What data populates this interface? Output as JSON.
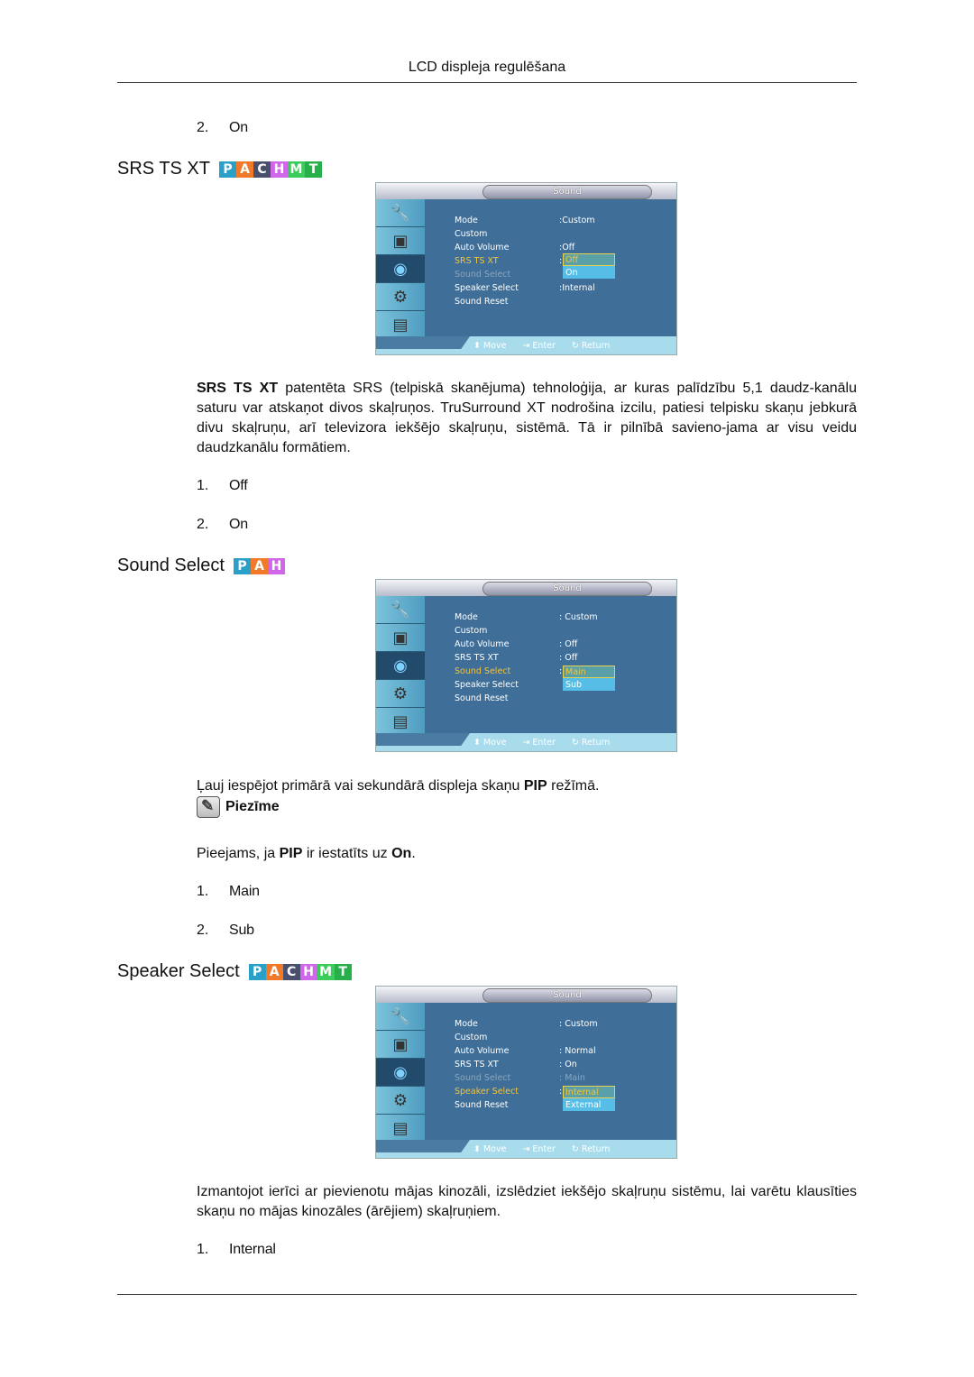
{
  "header": {
    "title": "LCD displeja regulēšana"
  },
  "top_list": [
    {
      "num": "2.",
      "label": "On"
    }
  ],
  "badge_colors": {
    "P": "#2aa0c8",
    "A": "#f07a2a",
    "C": "#4a4f6e",
    "H": "#d066e8",
    "M": "#3ccc5c",
    "T": "#27b04a"
  },
  "sections": [
    {
      "heading": "SRS TS XT",
      "badges": [
        "P",
        "A",
        "C",
        "H",
        "M",
        "T"
      ],
      "osd": {
        "title": "Sound",
        "rows": [
          {
            "label": "Mode",
            "value": ":Custom",
            "state": "normal"
          },
          {
            "label": "Custom",
            "value": "",
            "state": "normal"
          },
          {
            "label": "Auto Volume",
            "value": ":Off",
            "state": "normal"
          },
          {
            "label": "SRS TS XT",
            "value": ":",
            "state": "selected"
          },
          {
            "label": "Sound Select",
            "value": "",
            "state": "dim"
          },
          {
            "label": "Speaker Select",
            "value": ":Internal",
            "state": "normal"
          },
          {
            "label": "Sound Reset",
            "value": "",
            "state": "normal"
          }
        ],
        "dropdown": {
          "options": [
            "Off",
            "On"
          ],
          "highlighted": "Off"
        },
        "footer": {
          "move": "Move",
          "enter": "Enter",
          "return": "Return"
        }
      },
      "paragraph_bold": "SRS TS XT",
      "paragraph": " patentēta SRS (telpiskā skanējuma) tehnoloģija, ar kuras palīdzību 5,1 daudz-kanālu saturu var atskaņot divos skaļruņos. TruSurround XT nodrošina izcilu, patiesi telpisku skaņu jebkurā divu skaļruņu, arī televizora iekšējo skaļruņu, sistēmā. Tā ir pilnībā savieno-jama ar visu veidu daudzkanālu formātiem.",
      "list": [
        {
          "num": "1.",
          "label": "Off"
        },
        {
          "num": "2.",
          "label": "On"
        }
      ]
    },
    {
      "heading": "Sound Select",
      "badges": [
        "P",
        "A",
        "H"
      ],
      "osd": {
        "title": "Sound",
        "rows": [
          {
            "label": "Mode",
            "value": ": Custom",
            "state": "normal"
          },
          {
            "label": "Custom",
            "value": "",
            "state": "normal"
          },
          {
            "label": "Auto Volume",
            "value": ": Off",
            "state": "normal"
          },
          {
            "label": "SRS TS XT",
            "value": ": Off",
            "state": "normal"
          },
          {
            "label": "Sound Select",
            "value": ":",
            "state": "selected"
          },
          {
            "label": "Speaker Select",
            "value": "",
            "state": "normal"
          },
          {
            "label": "Sound Reset",
            "value": "",
            "state": "normal"
          }
        ],
        "dropdown": {
          "options": [
            "Main",
            "Sub"
          ],
          "highlighted": "Main"
        },
        "footer": {
          "move": "Move",
          "enter": "Enter",
          "return": "Return"
        }
      },
      "paragraph_pre": "Ļauj iespējot primārā vai sekundārā displeja skaņu ",
      "paragraph_bold": "PIP",
      "paragraph_post": " režīmā.",
      "note_label": "Piezīme",
      "note_pre": "Pieejams, ja ",
      "note_bold1": "PIP",
      "note_mid": " ir iestatīts uz ",
      "note_bold2": "On",
      "note_post": ".",
      "list": [
        {
          "num": "1.",
          "label": "Main"
        },
        {
          "num": "2.",
          "label": "Sub"
        }
      ]
    },
    {
      "heading": "Speaker Select",
      "badges": [
        "P",
        "A",
        "C",
        "H",
        "M",
        "T"
      ],
      "osd": {
        "title": "Sound",
        "rows": [
          {
            "label": "Mode",
            "value": ": Custom",
            "state": "normal"
          },
          {
            "label": "Custom",
            "value": "",
            "state": "normal"
          },
          {
            "label": "Auto Volume",
            "value": ": Normal",
            "state": "normal"
          },
          {
            "label": "SRS TS XT",
            "value": ":  On",
            "state": "normal"
          },
          {
            "label": "Sound Select",
            "value": ": Main",
            "state": "dim"
          },
          {
            "label": "Speaker Select",
            "value": ":",
            "state": "selected"
          },
          {
            "label": "Sound Reset",
            "value": "",
            "state": "normal"
          }
        ],
        "dropdown": {
          "options": [
            "Internal",
            "External"
          ],
          "highlighted": "Internal"
        },
        "footer": {
          "move": "Move",
          "enter": "Enter",
          "return": "Return"
        }
      },
      "paragraph": "Izmantojot ierīci ar pievienotu mājas kinozāli, izslēdziet iekšējo skaļruņu sistēmu, lai varētu klausīties skaņu no mājas kinozāles (ārējiem) skaļruņiem.",
      "list": [
        {
          "num": "1.",
          "label": "Internal"
        }
      ]
    }
  ]
}
